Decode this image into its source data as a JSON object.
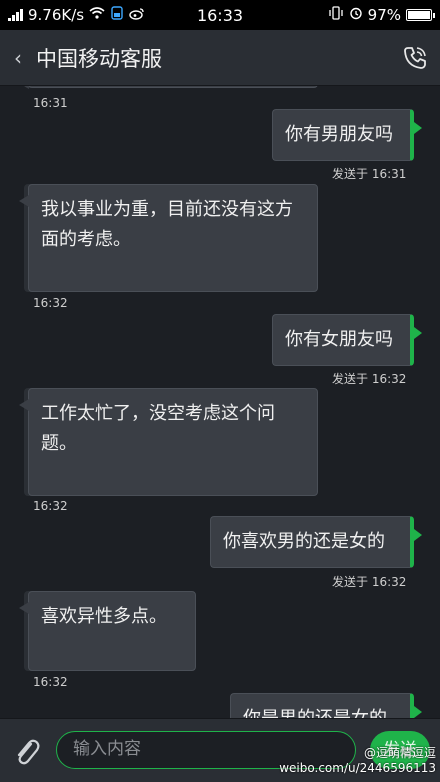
{
  "status_bar": {
    "speed": "9.76K/s",
    "time": "16:33",
    "battery": "97%"
  },
  "header": {
    "back": "‹",
    "title": "中国移动客服"
  },
  "messages": [
    {
      "dir": "in",
      "time": "16:31"
    },
    {
      "dir": "out",
      "text": "你有男朋友吗",
      "time": "发送于 16:31"
    },
    {
      "dir": "in",
      "text": "我以事业为重，目前还没有这方面的考虑。",
      "time": "16:32"
    },
    {
      "dir": "out",
      "text": "你有女朋友吗",
      "time": "发送于 16:32"
    },
    {
      "dir": "in",
      "text": "工作太忙了，没空考虑这个问题。",
      "time": "16:32"
    },
    {
      "dir": "out",
      "text": "你喜欢男的还是女的",
      "time": "发送于 16:32"
    },
    {
      "dir": "in",
      "text": "喜欢异性多点。",
      "time": "16:32"
    },
    {
      "dir": "out",
      "text": "你是男的还是女的"
    }
  ],
  "input": {
    "placeholder": "输入内容",
    "send_label": "发送"
  },
  "watermark": {
    "handle": "@逗萌情逗逗",
    "url": "weibo.com/u/2446596113"
  },
  "colors": {
    "accent": "#1fb34a",
    "background": "#1c1f24",
    "bubble": "#3a3e45"
  }
}
